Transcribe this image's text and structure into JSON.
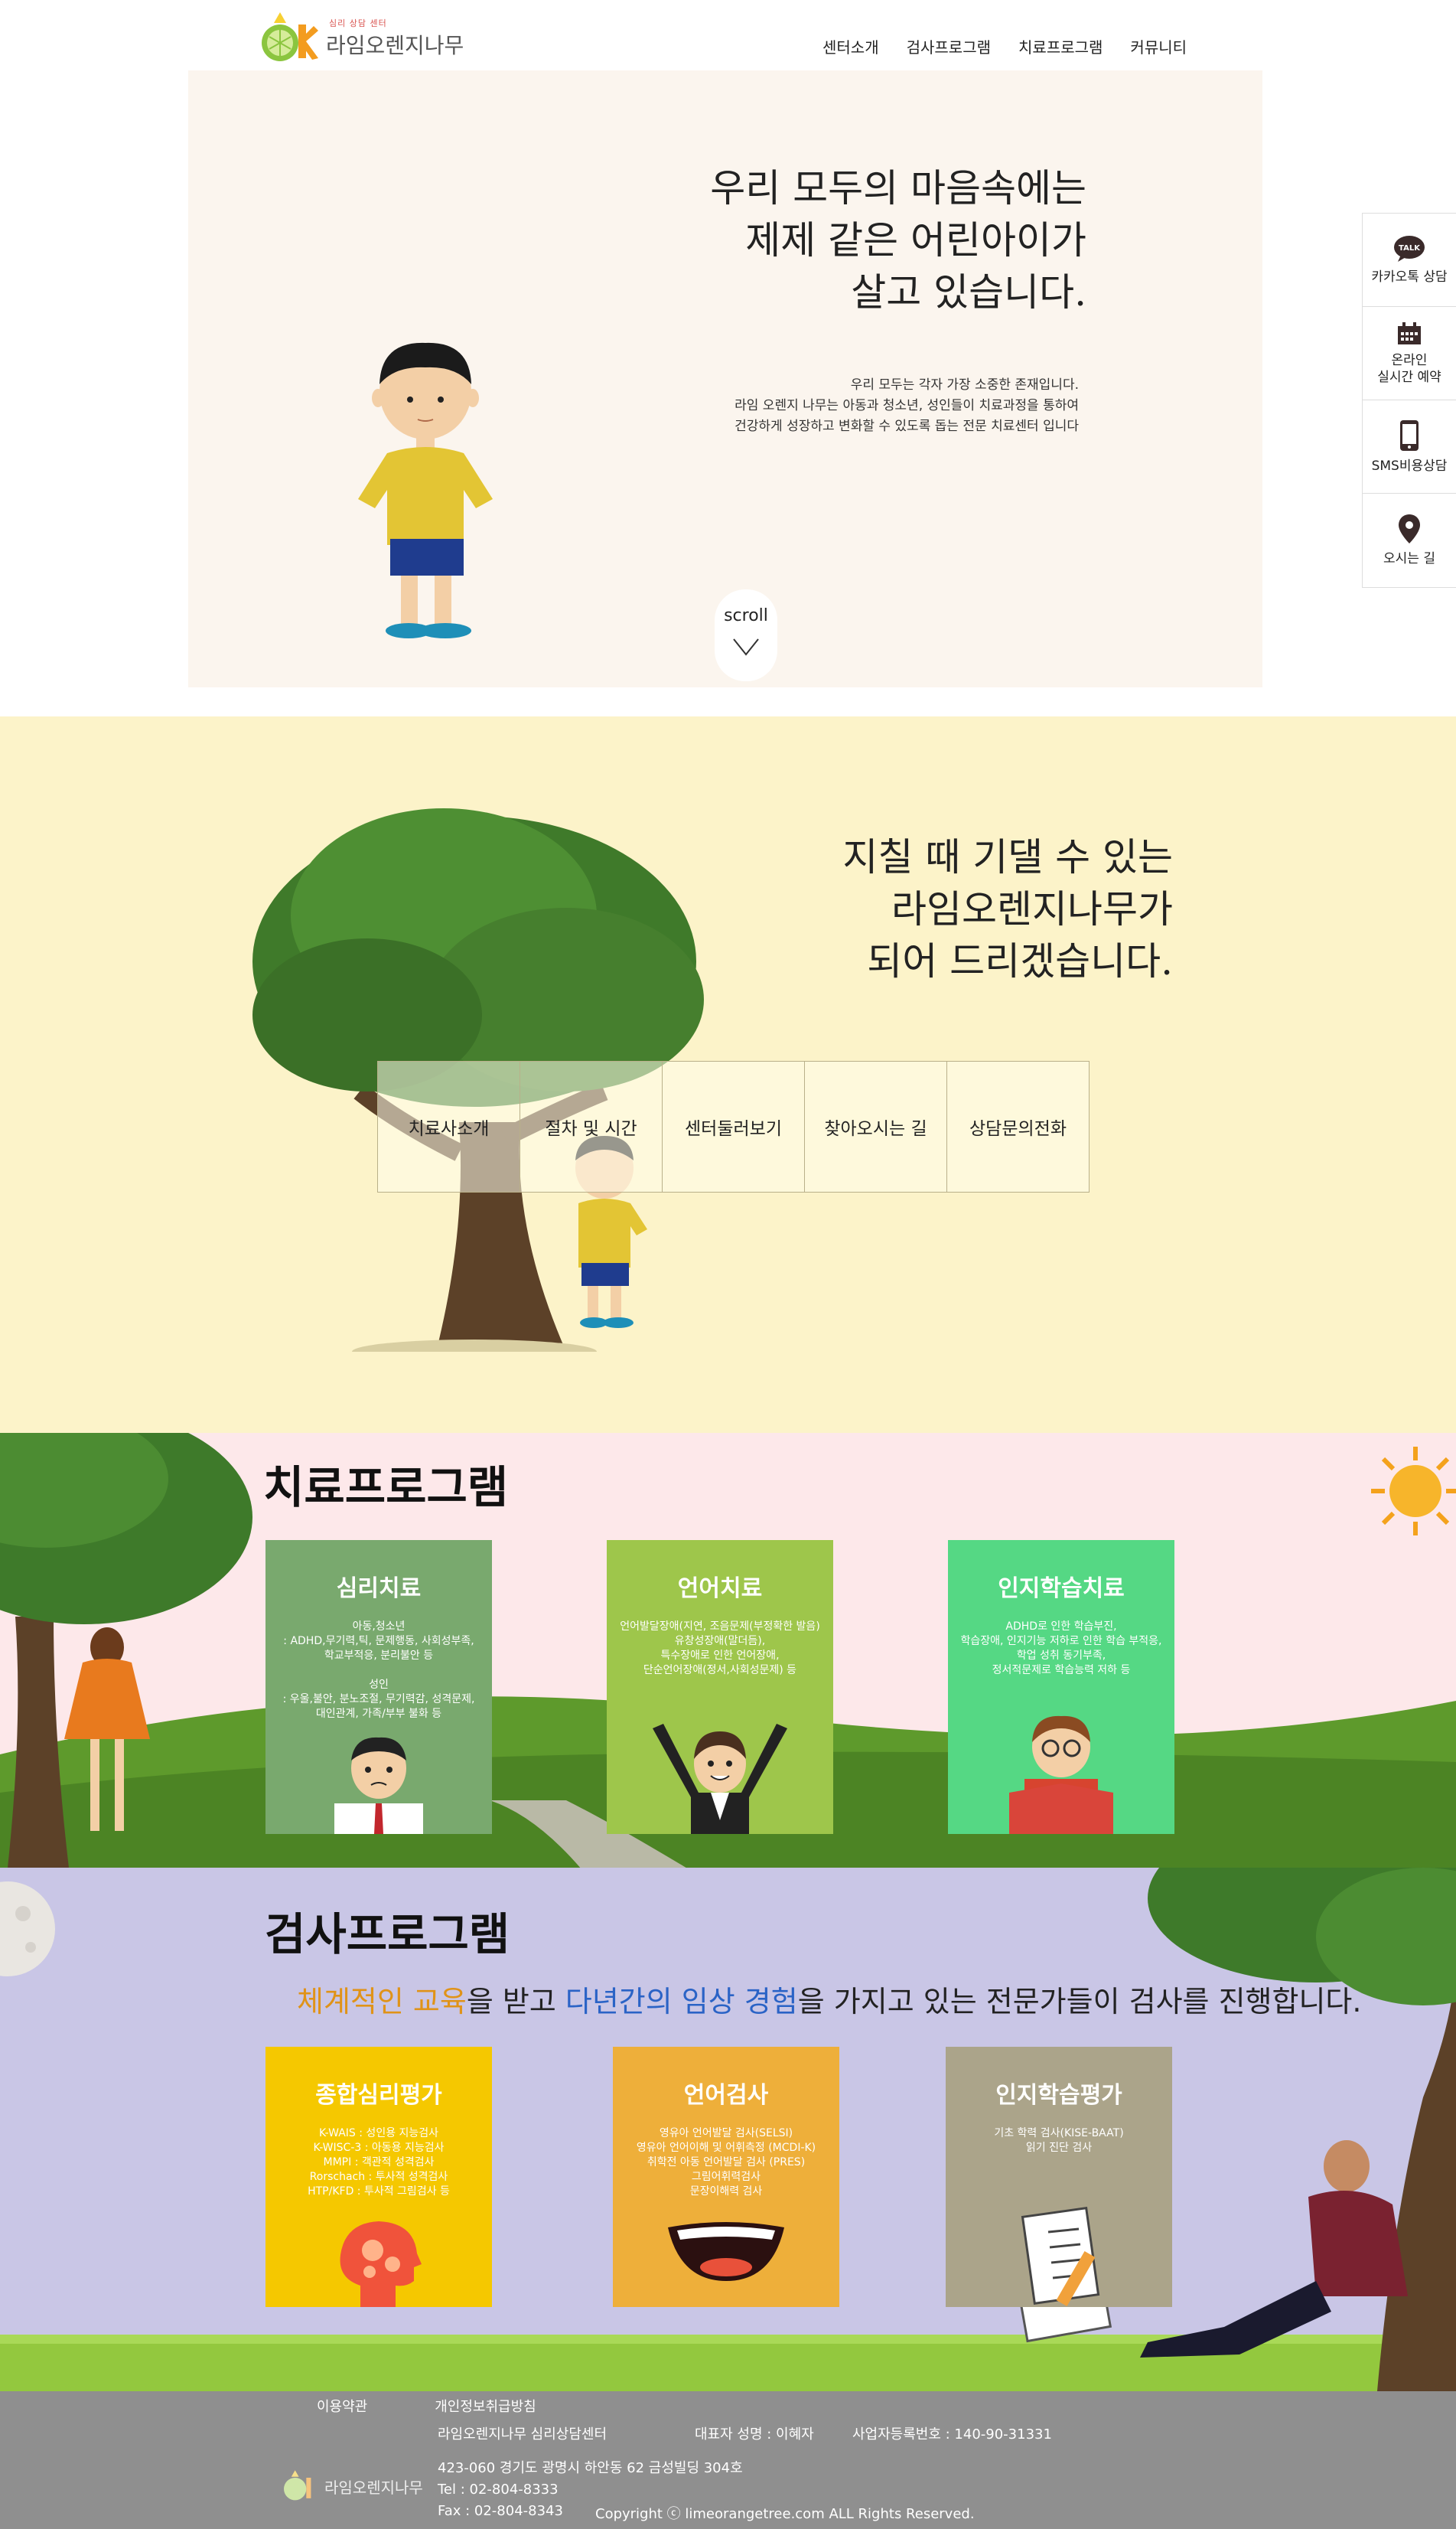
{
  "header": {
    "logo_small": "심리 상담 센터",
    "logo_name": "라임오렌지나무",
    "nav": [
      "센터소개",
      "검사프로그램",
      "치료프로그램",
      "커뮤니티"
    ]
  },
  "hero": {
    "title": [
      "우리 모두의 마음속에는",
      "제제 같은 어린아이가",
      "살고 있습니다."
    ],
    "sub": [
      "우리 모두는 각자 가장 소중한 존재입니다.",
      "라임 오렌지 나무는 아동과 청소년, 성인들이 치료과정을 통하여",
      "건강하게 성장하고 변화할 수 있도록 돕는 전문 치료센터 입니다"
    ],
    "scroll": "scroll"
  },
  "quick": [
    {
      "icon": "kakaotalk-icon",
      "label": "카카오톡 상담",
      "icon_text": "TALK"
    },
    {
      "icon": "calendar-icon",
      "label": "온라인\n실시간 예약"
    },
    {
      "icon": "mobile-phone-icon",
      "label": "SMS비용상담"
    },
    {
      "icon": "map-pin-icon",
      "label": "오시는 길"
    }
  ],
  "sec2": {
    "title": [
      "지칠 때 기댈 수 있는",
      "라임오렌지나무가",
      "되어 드리겠습니다."
    ],
    "menu": [
      "치료사소개",
      "절차 및 시간",
      "센터둘러보기",
      "찾아오시는 길",
      "상담문의전화"
    ]
  },
  "therapy": {
    "heading": "치료프로그램",
    "cards": [
      {
        "title": "심리치료",
        "color": "#79a96e",
        "desc": "아동,청소년\n: ADHD,무기력,틱, 문제행동, 사회성부족,\n학교부적응, 분리불안 등\n\n성인\n: 우울,불안, 분노조절, 무기력감, 성격문제,\n대인관계, 가족/부부 불화 등"
      },
      {
        "title": "언어치료",
        "color": "#9ec64b",
        "desc": "언어발달장애(지연, 조음문제(부정확한 발음)\n유창성장애(말더듬),\n특수장애로 인한 언어장애,\n단순언어장애(정서,사회성문제) 등"
      },
      {
        "title": "인지학습치료",
        "color": "#55d884",
        "desc": "ADHD로 인한 학습부진,\n학습장애, 인지기능 저하로 인한 학습 부적응,\n학업 성취 동기부족,\n정서적문제로 학습능력 저하 등"
      }
    ]
  },
  "assessment": {
    "heading": "검사프로그램",
    "sub_pre": "",
    "sub_o1": "체계적인 교육",
    "sub_mid": "을 받고 ",
    "sub_b1": "다년간의 임상 경험",
    "sub_post": "을 가지고 있는 전문가들이 검사를 진행합니다.",
    "cards": [
      {
        "title": "종합심리평가",
        "color": "#f5c800",
        "desc": "K-WAIS : 성인용 지능검사\nK-WISC-3 : 아동용 지능검사\nMMPI : 객관적 성격검사\nRorschach : 투사적 성격검사\nHTP/KFD : 투사적 그림검사 등"
      },
      {
        "title": "언어검사",
        "color": "#eeaf3a",
        "desc": "영유아 언어발달 검사(SELSI)\n영유아 언어이해 및 어휘측정 (MCDI-K)\n취학전 아동 언어발달 검사 (PRES)\n그림어휘력검사\n문장이해력 검사"
      },
      {
        "title": "인지학습평가",
        "color": "#aba48a",
        "desc": "기초 학력 검사(KISE-BAAT)\n읽기 진단 검사"
      }
    ]
  },
  "footer": {
    "links": [
      "이용약관",
      "개인정보취급방침"
    ],
    "center": "라임오렌지나무 심리상담센터",
    "ceo": "대표자 성명 : 이혜자",
    "bizno": "사업자등록번호 : 140-90-31331",
    "address": "423-060 경기도 광명시 하안동 62 금성빌딩 304호",
    "tel": "Tel : 02-804-8333",
    "fax": "Fax : 02-804-8343",
    "copyright": "Copyright ⓒ limeorangetree.com ALL Rights Reserved.",
    "logo_name": "라임오렌지나무"
  }
}
